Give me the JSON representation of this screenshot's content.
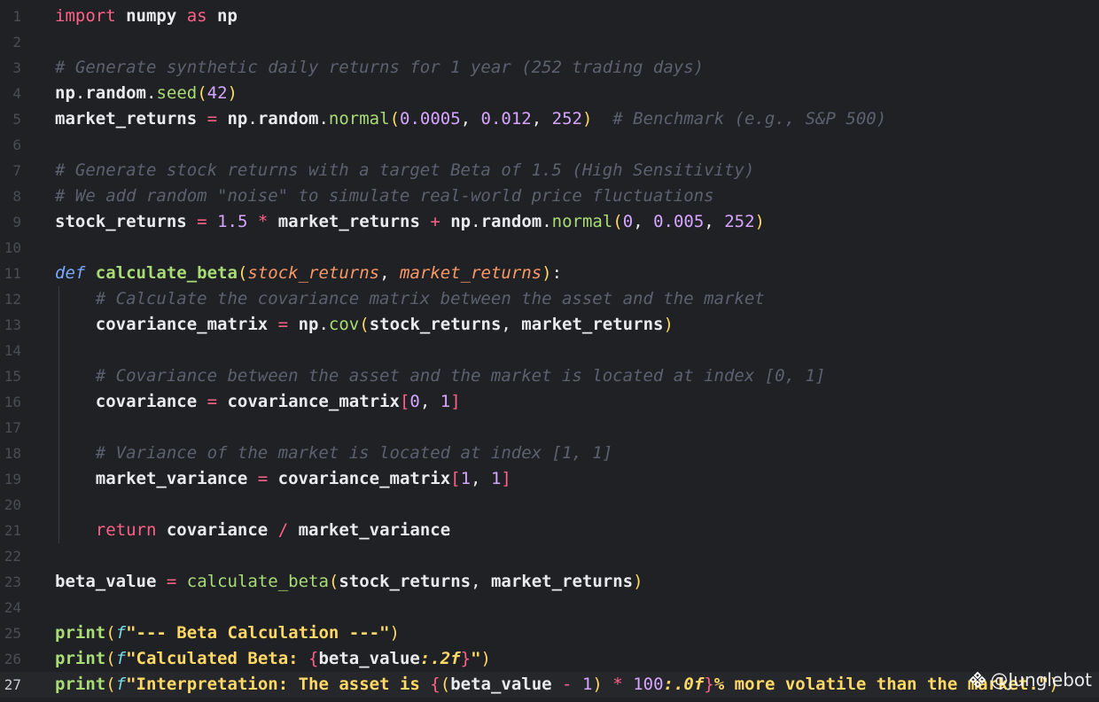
{
  "editor": {
    "current_line": 27,
    "line_numbers": [
      "1",
      "2",
      "3",
      "4",
      "5",
      "6",
      "7",
      "8",
      "9",
      "10",
      "11",
      "12",
      "13",
      "14",
      "15",
      "16",
      "17",
      "18",
      "19",
      "20",
      "21",
      "22",
      "23",
      "24",
      "25",
      "26",
      "27"
    ],
    "lines": [
      [
        {
          "t": "import",
          "c": "k-import"
        },
        {
          "t": " numpy ",
          "c": "ident"
        },
        {
          "t": "as",
          "c": "k-import"
        },
        {
          "t": " np",
          "c": "ident"
        }
      ],
      [],
      [
        {
          "t": "# Generate synthetic daily returns for 1 year (252 trading days)",
          "c": "comment"
        }
      ],
      [
        {
          "t": "np",
          "c": "ident"
        },
        {
          "t": ".",
          "c": "punc"
        },
        {
          "t": "random",
          "c": "ident"
        },
        {
          "t": ".",
          "c": "punc"
        },
        {
          "t": "seed",
          "c": "func"
        },
        {
          "t": "(",
          "c": "paren"
        },
        {
          "t": "42",
          "c": "num"
        },
        {
          "t": ")",
          "c": "paren"
        }
      ],
      [
        {
          "t": "market_returns ",
          "c": "ident"
        },
        {
          "t": "=",
          "c": "op"
        },
        {
          "t": " np",
          "c": "ident"
        },
        {
          "t": ".",
          "c": "punc"
        },
        {
          "t": "random",
          "c": "ident"
        },
        {
          "t": ".",
          "c": "punc"
        },
        {
          "t": "normal",
          "c": "func"
        },
        {
          "t": "(",
          "c": "paren"
        },
        {
          "t": "0.0005",
          "c": "num"
        },
        {
          "t": ", ",
          "c": "punc"
        },
        {
          "t": "0.012",
          "c": "num"
        },
        {
          "t": ", ",
          "c": "punc"
        },
        {
          "t": "252",
          "c": "num"
        },
        {
          "t": ")",
          "c": "paren"
        },
        {
          "t": "  # Benchmark (e.g., S&P 500)",
          "c": "comment"
        }
      ],
      [],
      [
        {
          "t": "# Generate stock returns with a target Beta of 1.5 (High Sensitivity)",
          "c": "comment"
        }
      ],
      [
        {
          "t": "# We add random \"noise\" to simulate real-world price fluctuations",
          "c": "comment"
        }
      ],
      [
        {
          "t": "stock_returns ",
          "c": "ident"
        },
        {
          "t": "=",
          "c": "op"
        },
        {
          "t": " ",
          "c": "punc"
        },
        {
          "t": "1.5",
          "c": "num"
        },
        {
          "t": " ",
          "c": "punc"
        },
        {
          "t": "*",
          "c": "op"
        },
        {
          "t": " market_returns ",
          "c": "ident"
        },
        {
          "t": "+",
          "c": "op"
        },
        {
          "t": " np",
          "c": "ident"
        },
        {
          "t": ".",
          "c": "punc"
        },
        {
          "t": "random",
          "c": "ident"
        },
        {
          "t": ".",
          "c": "punc"
        },
        {
          "t": "normal",
          "c": "func"
        },
        {
          "t": "(",
          "c": "paren"
        },
        {
          "t": "0",
          "c": "num"
        },
        {
          "t": ", ",
          "c": "punc"
        },
        {
          "t": "0.005",
          "c": "num"
        },
        {
          "t": ", ",
          "c": "punc"
        },
        {
          "t": "252",
          "c": "num"
        },
        {
          "t": ")",
          "c": "paren"
        }
      ],
      [],
      [
        {
          "t": "def",
          "c": "k-def"
        },
        {
          "t": " ",
          "c": "punc"
        },
        {
          "t": "calculate_beta",
          "c": "fdef"
        },
        {
          "t": "(",
          "c": "paren"
        },
        {
          "t": "stock_returns",
          "c": "param"
        },
        {
          "t": ", ",
          "c": "punc"
        },
        {
          "t": "market_returns",
          "c": "param"
        },
        {
          "t": ")",
          "c": "paren"
        },
        {
          "t": ":",
          "c": "punc"
        }
      ],
      [
        {
          "t": "    # Calculate the covariance matrix between the asset and the market",
          "c": "comment"
        }
      ],
      [
        {
          "t": "    covariance_matrix ",
          "c": "ident"
        },
        {
          "t": "=",
          "c": "op"
        },
        {
          "t": " np",
          "c": "ident"
        },
        {
          "t": ".",
          "c": "punc"
        },
        {
          "t": "cov",
          "c": "func"
        },
        {
          "t": "(",
          "c": "paren"
        },
        {
          "t": "stock_returns",
          "c": "ident"
        },
        {
          "t": ", ",
          "c": "punc"
        },
        {
          "t": "market_returns",
          "c": "ident"
        },
        {
          "t": ")",
          "c": "paren"
        }
      ],
      [],
      [
        {
          "t": "    # Covariance between the asset and the market is located at index [0, 1]",
          "c": "comment"
        }
      ],
      [
        {
          "t": "    covariance ",
          "c": "ident"
        },
        {
          "t": "=",
          "c": "op"
        },
        {
          "t": " covariance_matrix",
          "c": "ident"
        },
        {
          "t": "[",
          "c": "brace"
        },
        {
          "t": "0",
          "c": "num"
        },
        {
          "t": ", ",
          "c": "punc"
        },
        {
          "t": "1",
          "c": "num"
        },
        {
          "t": "]",
          "c": "brace"
        }
      ],
      [],
      [
        {
          "t": "    # Variance of the market is located at index [1, 1]",
          "c": "comment"
        }
      ],
      [
        {
          "t": "    market_variance ",
          "c": "ident"
        },
        {
          "t": "=",
          "c": "op"
        },
        {
          "t": " covariance_matrix",
          "c": "ident"
        },
        {
          "t": "[",
          "c": "brace"
        },
        {
          "t": "1",
          "c": "num"
        },
        {
          "t": ", ",
          "c": "punc"
        },
        {
          "t": "1",
          "c": "num"
        },
        {
          "t": "]",
          "c": "brace"
        }
      ],
      [],
      [
        {
          "t": "    ",
          "c": "punc"
        },
        {
          "t": "return",
          "c": "k-return"
        },
        {
          "t": " covariance ",
          "c": "ident"
        },
        {
          "t": "/",
          "c": "op"
        },
        {
          "t": " market_variance",
          "c": "ident"
        }
      ],
      [],
      [
        {
          "t": "beta_value ",
          "c": "ident"
        },
        {
          "t": "=",
          "c": "op"
        },
        {
          "t": " ",
          "c": "punc"
        },
        {
          "t": "calculate_beta",
          "c": "func"
        },
        {
          "t": "(",
          "c": "paren"
        },
        {
          "t": "stock_returns",
          "c": "ident"
        },
        {
          "t": ", ",
          "c": "punc"
        },
        {
          "t": "market_returns",
          "c": "ident"
        },
        {
          "t": ")",
          "c": "paren"
        }
      ],
      [],
      [
        {
          "t": "print",
          "c": "fdef"
        },
        {
          "t": "(",
          "c": "paren"
        },
        {
          "t": "f",
          "c": "fpre"
        },
        {
          "t": "\"--- Beta Calculation ---\"",
          "c": "str"
        },
        {
          "t": ")",
          "c": "paren"
        }
      ],
      [
        {
          "t": "print",
          "c": "fdef"
        },
        {
          "t": "(",
          "c": "paren"
        },
        {
          "t": "f",
          "c": "fpre"
        },
        {
          "t": "\"Calculated Beta: ",
          "c": "str"
        },
        {
          "t": "{",
          "c": "brace"
        },
        {
          "t": "beta_value",
          "c": "ident"
        },
        {
          "t": ":.2f",
          "c": "fmt"
        },
        {
          "t": "}",
          "c": "brace"
        },
        {
          "t": "\"",
          "c": "str"
        },
        {
          "t": ")",
          "c": "paren"
        }
      ],
      [
        {
          "t": "print",
          "c": "fdef"
        },
        {
          "t": "(",
          "c": "paren"
        },
        {
          "t": "f",
          "c": "fpre"
        },
        {
          "t": "\"Interpretation: The asset is ",
          "c": "str"
        },
        {
          "t": "{",
          "c": "brace"
        },
        {
          "t": "(",
          "c": "paren"
        },
        {
          "t": "beta_value ",
          "c": "ident"
        },
        {
          "t": "-",
          "c": "op"
        },
        {
          "t": " ",
          "c": "punc"
        },
        {
          "t": "1",
          "c": "num"
        },
        {
          "t": ")",
          "c": "paren"
        },
        {
          "t": " ",
          "c": "punc"
        },
        {
          "t": "*",
          "c": "op"
        },
        {
          "t": " ",
          "c": "punc"
        },
        {
          "t": "100",
          "c": "num"
        },
        {
          "t": ":.0f",
          "c": "fmt"
        },
        {
          "t": "}",
          "c": "brace"
        },
        {
          "t": "% more volatile than the market.\"",
          "c": "str"
        },
        {
          "t": ")",
          "c": "paren"
        }
      ]
    ]
  },
  "watermark": {
    "text": "@Junglebot",
    "icon": "junglebot-logo-icon"
  }
}
